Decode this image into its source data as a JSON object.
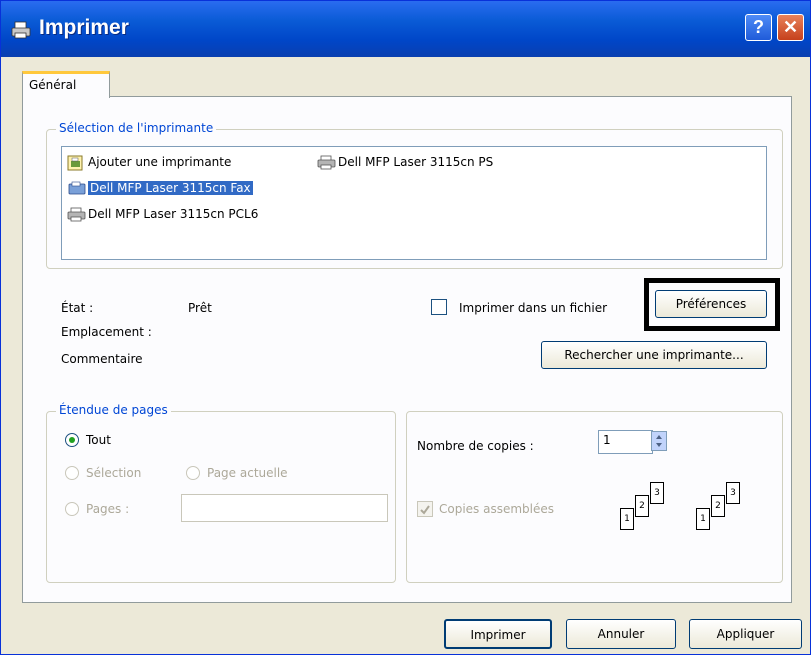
{
  "window": {
    "title": "Imprimer",
    "help_label": "?",
    "close_label": "✕"
  },
  "tabs": [
    {
      "label": "Général"
    }
  ],
  "printer_selection": {
    "group_label": "Sélection de l'imprimante",
    "printers": [
      {
        "name": "Ajouter une imprimante",
        "icon": "add-printer-icon",
        "selected": false
      },
      {
        "name": "Dell MFP Laser 3115cn PS",
        "icon": "printer-icon",
        "selected": false
      },
      {
        "name": "Dell MFP Laser 3115cn Fax",
        "icon": "fax-icon",
        "selected": true
      },
      {
        "name": "Dell MFP Laser 3115cn PCL6",
        "icon": "printer-icon",
        "selected": false
      }
    ]
  },
  "status": {
    "state_label": "État :",
    "state_value": "Prêt",
    "location_label": "Emplacement :",
    "comment_label": "Commentaire"
  },
  "print_to_file_label": "Imprimer dans un fichier",
  "preferences_label": "Préférences",
  "find_printer_label": "Rechercher une imprimante...",
  "page_range": {
    "group_label": "Étendue de pages",
    "all_label": "Tout",
    "selection_label": "Sélection",
    "current_page_label": "Page actuelle",
    "pages_label": "Pages :",
    "pages_value": ""
  },
  "copies": {
    "count_label": "Nombre de copies :",
    "count_value": "1",
    "collate_label": "Copies assemblées",
    "collate_checked": true,
    "collate_icon_pages": [
      "1",
      "2",
      "3"
    ]
  },
  "buttons": {
    "print": "Imprimer",
    "cancel": "Annuler",
    "apply": "Appliquer"
  },
  "colors": {
    "titlebar": "#0a5bd6",
    "selection": "#316ac5",
    "group_label": "#0046d5",
    "radio_dot": "#21a121"
  }
}
